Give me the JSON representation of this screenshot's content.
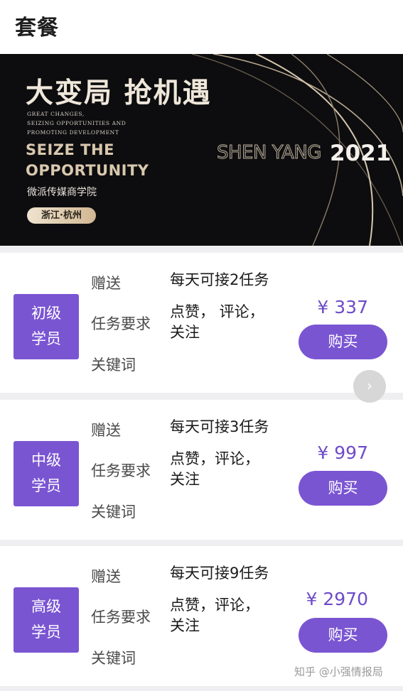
{
  "header": {
    "title": "套餐"
  },
  "banner": {
    "headline": "大变局 抢机遇",
    "small_lines": [
      "GREAT CHANGES,",
      "SEIZING OPPORTUNITIES AND",
      "PROMOTING DEVELOPMENT"
    ],
    "english_line1": "SEIZE THE",
    "english_line2": "OPPORTUNITY",
    "school": "微派传媒商学院",
    "location_pill": "浙江·杭州",
    "city": "SHEN YANG",
    "year": "2021"
  },
  "plans": [
    {
      "tier_line1": "初级",
      "tier_line2": "学员",
      "gift_label": "赠送",
      "gift_value": "每天可接2任务",
      "req_label": "任务要求",
      "req_value_line1": "点赞， 评论，",
      "req_value_line2": "关注",
      "keyword_label": "关键词",
      "price": "¥ 337",
      "buy_label": "购买"
    },
    {
      "tier_line1": "中级",
      "tier_line2": "学员",
      "gift_label": "赠送",
      "gift_value": "每天可接3任务",
      "req_label": "任务要求",
      "req_value_line1": "点赞，评论，",
      "req_value_line2": "关注",
      "keyword_label": "关键词",
      "price": "¥ 997",
      "buy_label": "购买"
    },
    {
      "tier_line1": "高级",
      "tier_line2": "学员",
      "gift_label": "赠送",
      "gift_value": "每天可接9任务",
      "req_label": "任务要求",
      "req_value_line1": "点赞，评论，",
      "req_value_line2": "关注",
      "keyword_label": "关键词",
      "price": "¥ 2970",
      "buy_label": "购买"
    }
  ],
  "scroll_button": {
    "icon": "chevron-right-icon",
    "glyph": "›"
  },
  "watermark": "知乎 @小强情报局",
  "colors": {
    "accent": "#7a55d2",
    "price": "#6e4bc8",
    "banner_bg": "#0d0d0f",
    "gold": "#d9c8ae"
  }
}
